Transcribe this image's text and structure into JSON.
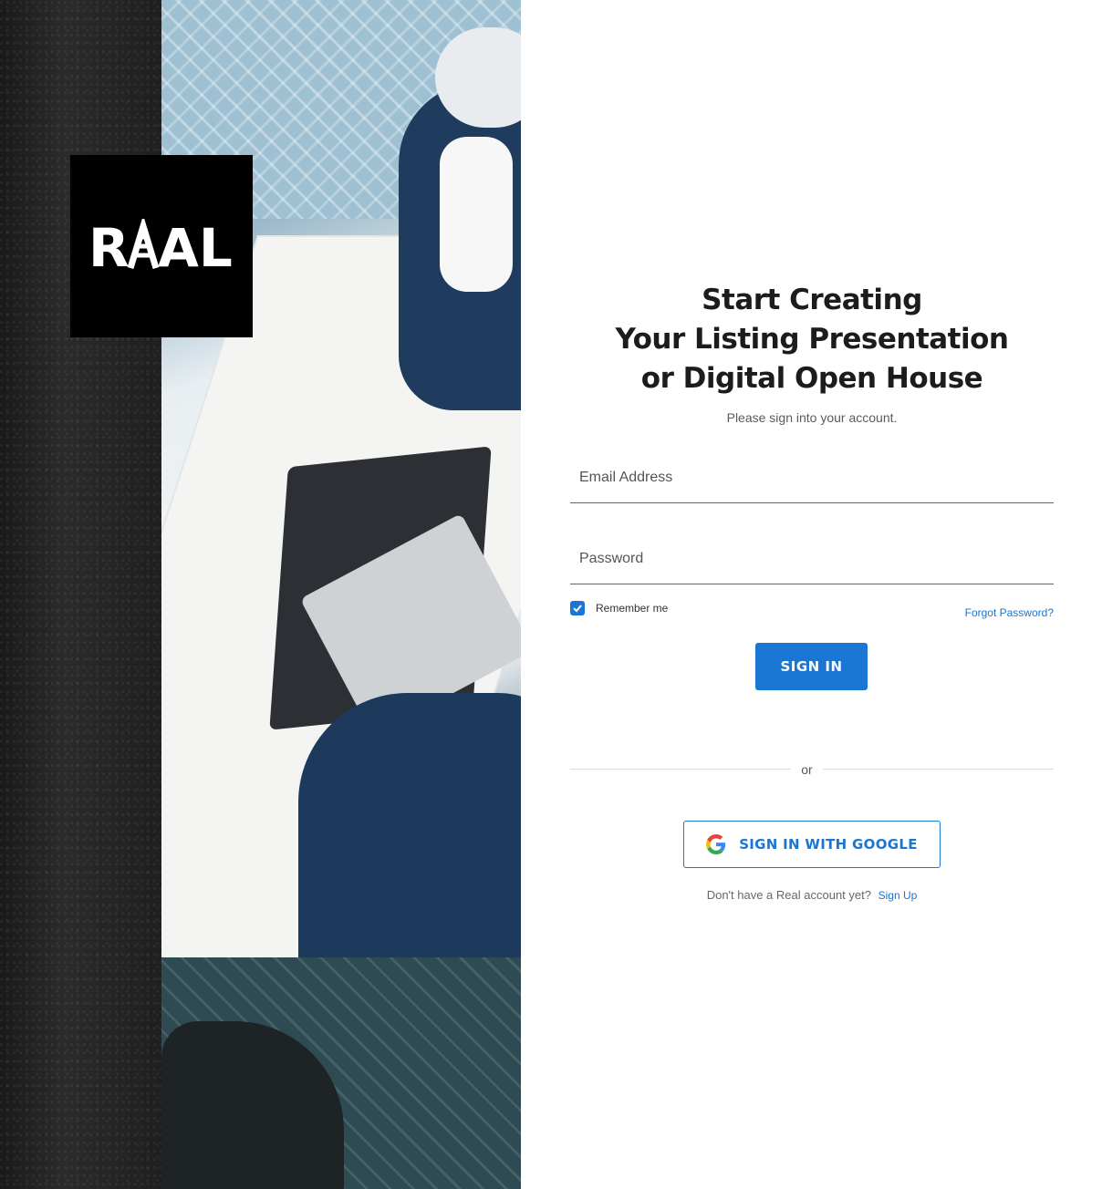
{
  "brand": {
    "logo_text": "REAL"
  },
  "heading": {
    "line1": "Start Creating",
    "line2": "Your Listing Presentation",
    "line3": "or Digital Open House"
  },
  "subtitle": "Please sign into your account.",
  "form": {
    "email_placeholder": "Email Address",
    "password_placeholder": "Password",
    "remember_label": "Remember me",
    "remember_checked": true,
    "forgot_label": "Forgot Password?",
    "signin_label": "SIGN IN",
    "or_label": "or",
    "google_label": "SIGN IN WITH GOOGLE"
  },
  "signup": {
    "prompt": "Don't have a Real account yet?",
    "link_label": "Sign Up"
  },
  "colors": {
    "accent": "#1976d2",
    "logo_bg": "#000000",
    "text": "#1c1c1c"
  }
}
